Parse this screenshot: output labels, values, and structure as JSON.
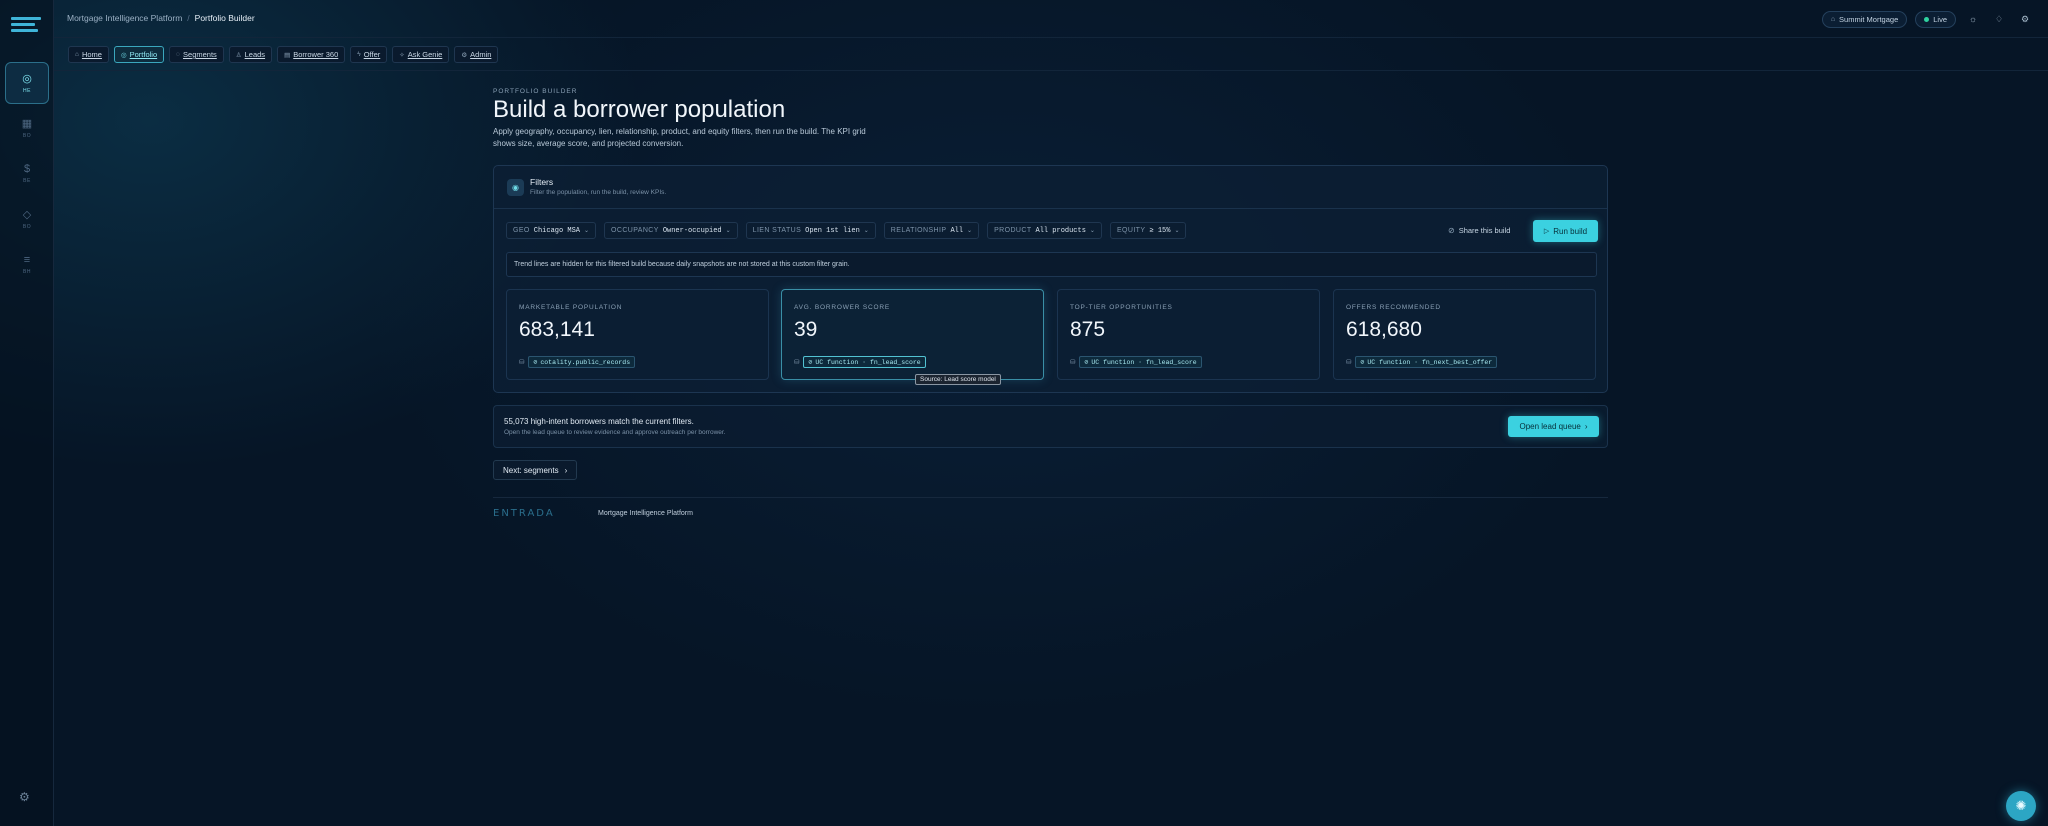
{
  "breadcrumb": {
    "root": "Mortgage Intelligence Platform",
    "separator": "/",
    "current": "Portfolio Builder"
  },
  "topbar": {
    "tenant": "Summit Mortgage",
    "status": "Live",
    "icons": [
      "sun-icon",
      "bell-icon",
      "settings-icon"
    ]
  },
  "rail": {
    "items": [
      {
        "label": "HE",
        "icon": "target-icon",
        "active": true
      },
      {
        "label": "BO",
        "icon": "grid-icon",
        "active": false
      },
      {
        "label": "BE",
        "icon": "dollar-icon",
        "active": false
      },
      {
        "label": "BO",
        "icon": "shield-icon",
        "active": false
      },
      {
        "label": "BH",
        "icon": "filter-icon",
        "active": false
      }
    ]
  },
  "nav": {
    "tabs": [
      {
        "label": "Home",
        "icon": "home-icon",
        "active": false
      },
      {
        "label": "Portfolio",
        "icon": "target-icon",
        "active": true
      },
      {
        "label": "Segments",
        "icon": "chat-icon",
        "active": false
      },
      {
        "label": "Leads",
        "icon": "user-icon",
        "active": false
      },
      {
        "label": "Borrower 360",
        "icon": "doc-icon",
        "active": false
      },
      {
        "label": "Offer",
        "icon": "bolt-icon",
        "active": false
      },
      {
        "label": "Ask Genie",
        "icon": "sparkle-icon",
        "active": false
      },
      {
        "label": "Admin",
        "icon": "gear-icon",
        "active": false
      }
    ]
  },
  "header": {
    "eyebrow": "PORTFOLIO BUILDER",
    "title": "Build a borrower population",
    "description": "Apply geography, occupancy, lien, relationship, product, and equity filters, then run the build. The KPI grid shows size, average score, and projected conversion."
  },
  "filters_card": {
    "title": "Filters",
    "subtitle": "Filter the population, run the build, review KPIs.",
    "filters": [
      {
        "key": "GEO",
        "value": "Chicago MSA"
      },
      {
        "key": "OCCUPANCY",
        "value": "Owner-occupied"
      },
      {
        "key": "LIEN STATUS",
        "value": "Open 1st lien"
      },
      {
        "key": "RELATIONSHIP",
        "value": "All"
      },
      {
        "key": "PRODUCT",
        "value": "All products"
      },
      {
        "key": "EQUITY",
        "value": "≥ 15%"
      }
    ],
    "share_label": "Share this build",
    "run_label": "Run build",
    "notice": "Trend lines are hidden for this filtered build because daily snapshots are not stored at this custom filter grain."
  },
  "kpis": [
    {
      "label": "MARKETABLE POPULATION",
      "value": "683,141",
      "source": "cotality.public_records",
      "highlight": false
    },
    {
      "label": "AVG. BORROWER SCORE",
      "value": "39",
      "source": "UC function · fn_lead_score",
      "highlight": true
    },
    {
      "label": "TOP-TIER OPPORTUNITIES",
      "value": "875",
      "source": "UC function · fn_lead_score",
      "highlight": false
    },
    {
      "label": "OFFERS RECOMMENDED",
      "value": "618,680",
      "source": "UC function · fn_next_best_offer",
      "highlight": false
    }
  ],
  "tooltip": "Source: Lead score model",
  "intent": {
    "title": "55,073 high-intent borrowers match the current filters.",
    "subtitle": "Open the lead queue to review evidence and approve outreach per borrower.",
    "button": "Open lead queue"
  },
  "next_button": "Next: segments",
  "footer": {
    "logo": "ENTRADA",
    "text": "Mortgage Intelligence Platform"
  },
  "colors": {
    "accent": "#3bd1e0",
    "background": "#061526",
    "card": "#0c1e34"
  }
}
